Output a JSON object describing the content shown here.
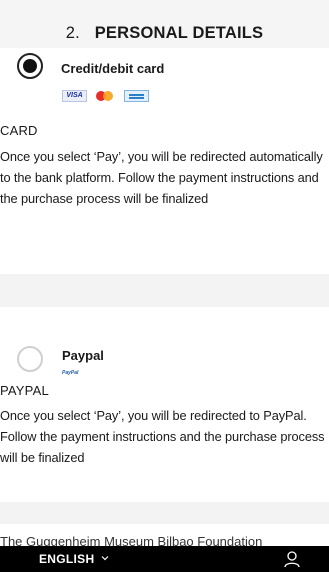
{
  "header": {
    "step_number": "2.",
    "title": "PERSONAL DETAILS"
  },
  "credit_card": {
    "method_label": "Credit/debit card",
    "logos": [
      "VISA",
      "mastercard",
      "amex"
    ],
    "visa_text": "VISA",
    "section_label": "CARD",
    "description": "Once you select ‘Pay’, you will be redirected automatically to the bank platform. Follow the payment instructions and the purchase process will be finalized",
    "selected": true
  },
  "paypal": {
    "method_label": "Paypal",
    "logo_text": "PayPal",
    "section_label": "PAYPAL",
    "description": "Once you select ‘Pay’, you will be redirected to PayPal. Follow the payment instructions and the purchase process will be finalized",
    "selected": false
  },
  "footer_preview": {
    "text": "The Guggenheim Museum Bilbao Foundation"
  },
  "bottom_bar": {
    "language": "ENGLISH",
    "icons": [
      "chevron-down-icon",
      "user-icon"
    ]
  },
  "colors": {
    "bottom_bar_bg": "#000000",
    "page_bg": "#f3f3f3",
    "card_bg": "#ffffff"
  }
}
